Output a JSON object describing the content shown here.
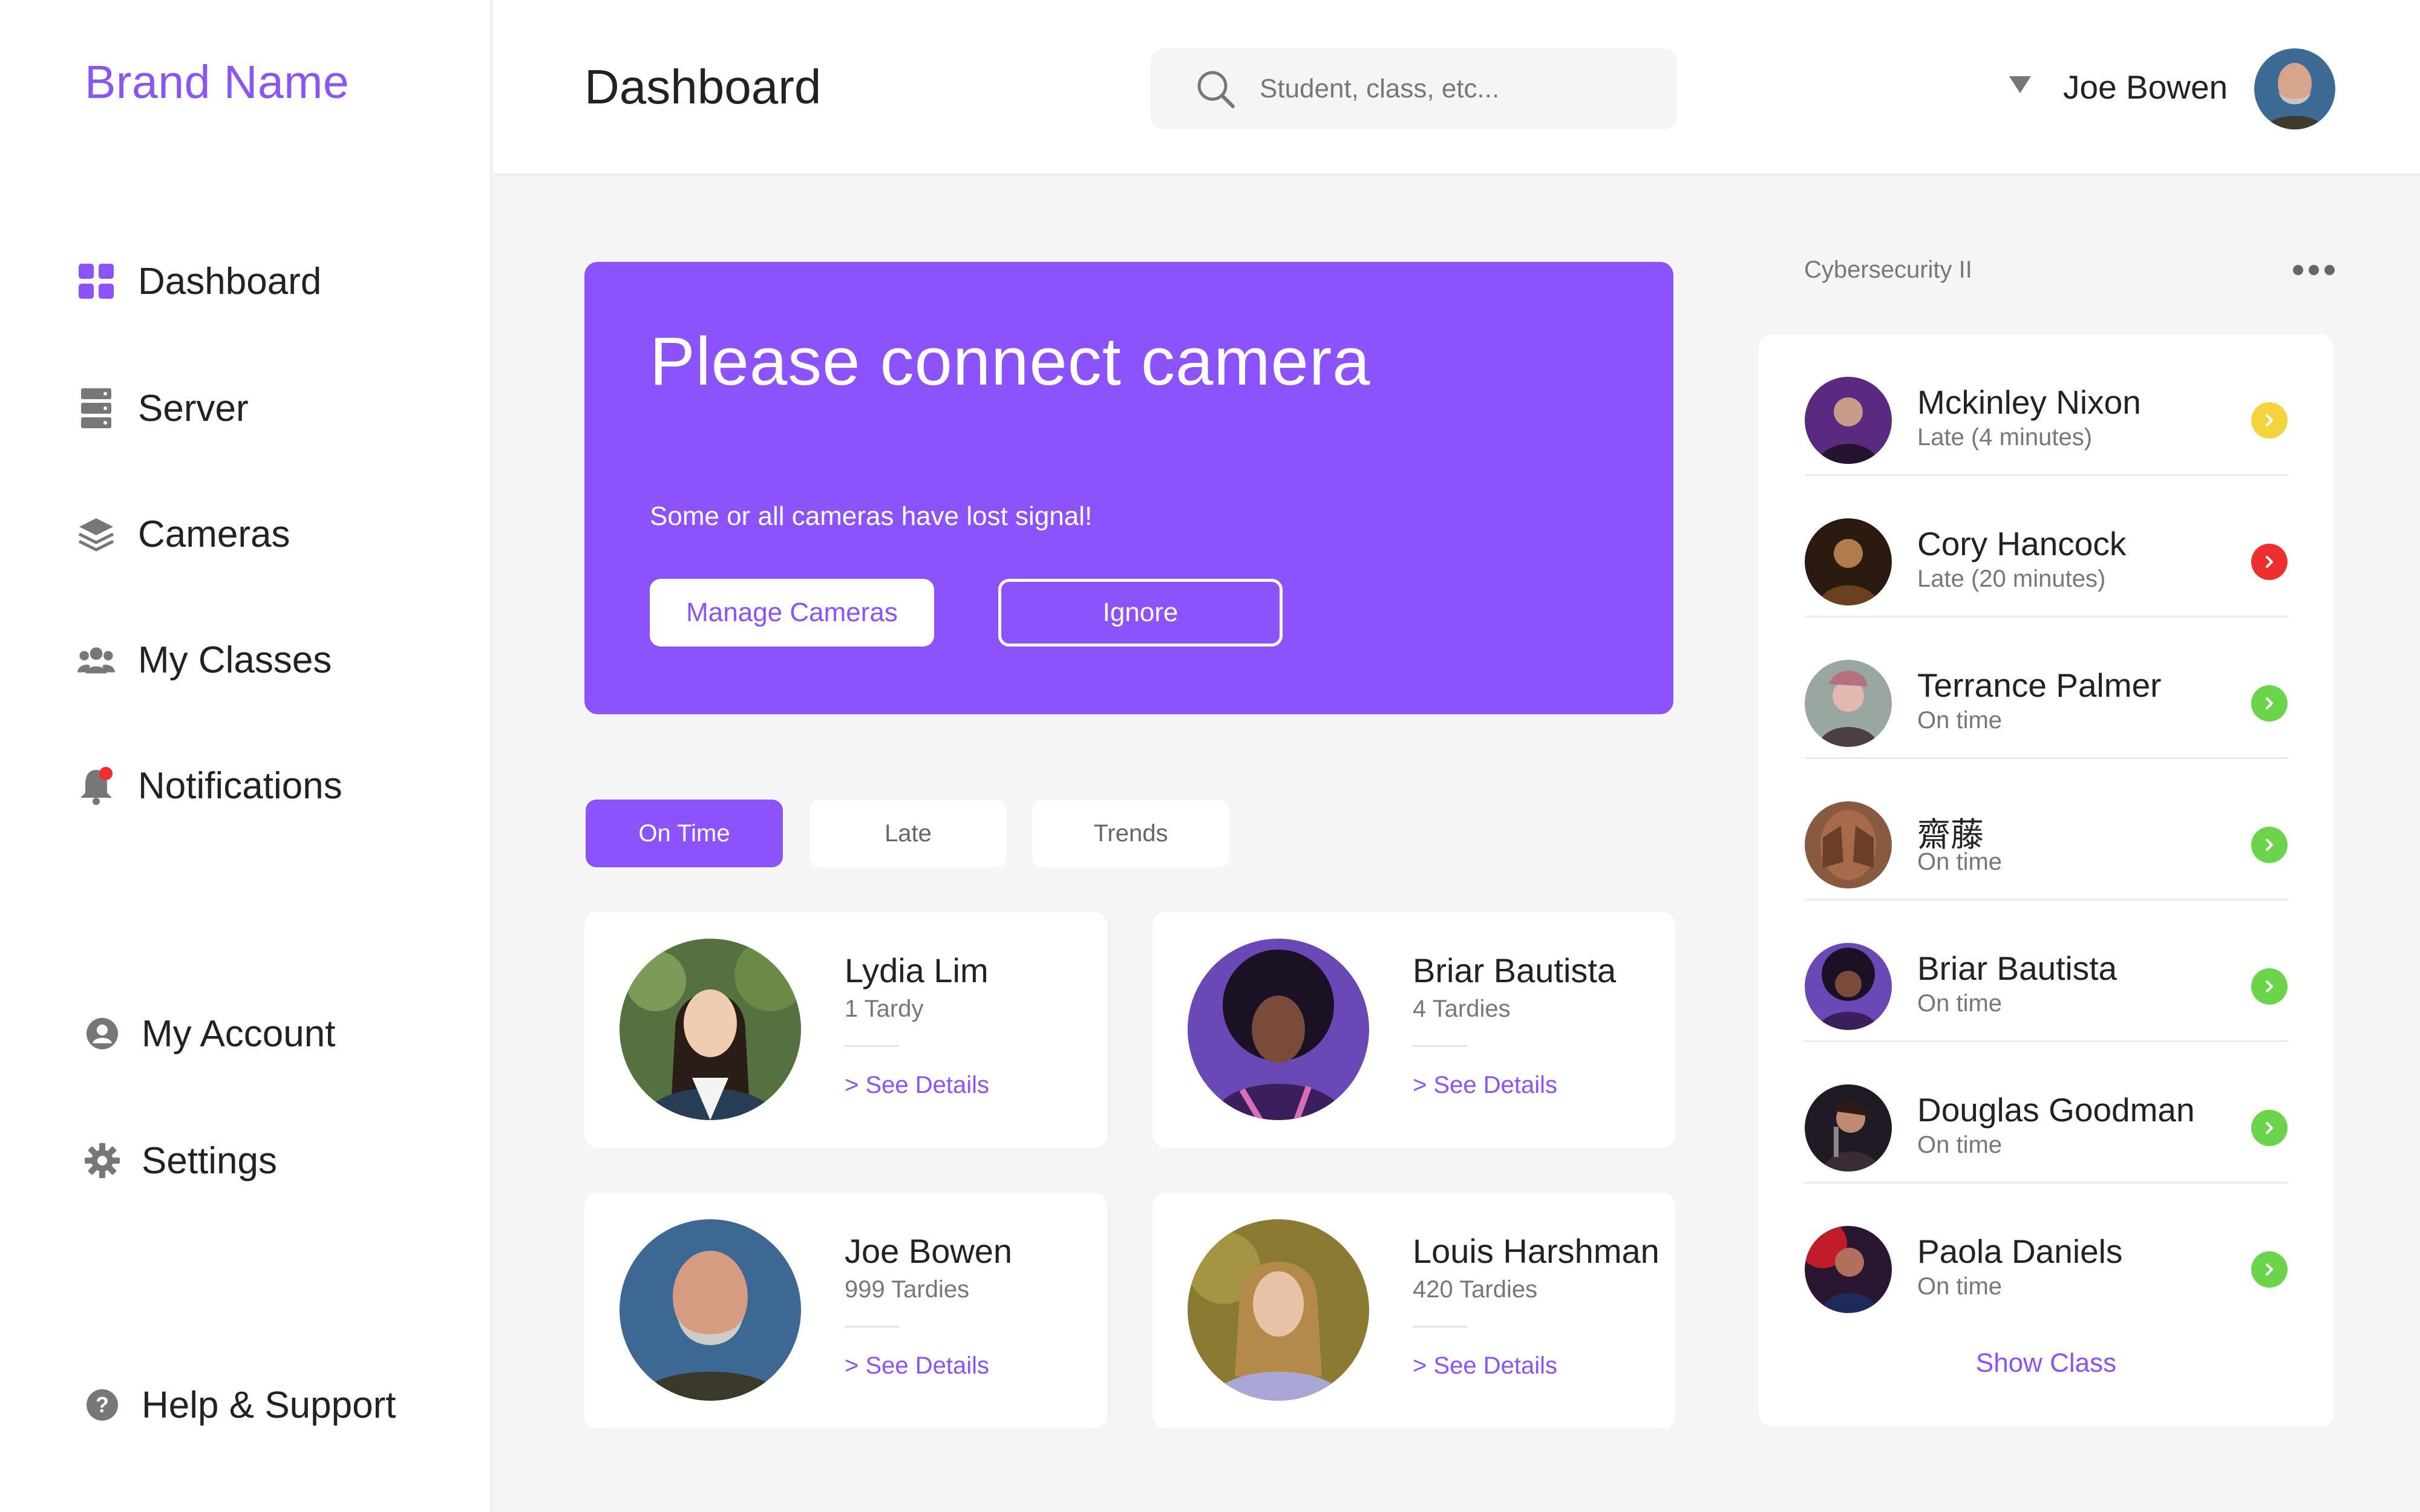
{
  "brand": "Brand Name",
  "nav": {
    "dashboard": "Dashboard",
    "server": "Server",
    "cameras": "Cameras",
    "my_classes": "My Classes",
    "notifications": "Notifications",
    "my_account": "My Account",
    "settings": "Settings",
    "help": "Help & Support"
  },
  "header": {
    "title": "Dashboard",
    "search_placeholder": "Student, class, etc...",
    "user_name": "Joe Bowen"
  },
  "alert": {
    "title": "Please connect camera",
    "subtitle": "Some or all cameras have lost signal!",
    "manage_label": "Manage Cameras",
    "ignore_label": "Ignore"
  },
  "tabs": [
    "On Time",
    "Late",
    "Trends"
  ],
  "cards": [
    {
      "name": "Lydia Lim",
      "sub": "1 Tardy",
      "link": "> See Details"
    },
    {
      "name": "Briar Bautista",
      "sub": "4 Tardies",
      "link": "> See Details"
    },
    {
      "name": "Joe Bowen",
      "sub": "999 Tardies",
      "link": "> See Details"
    },
    {
      "name": "Louis Harshman",
      "sub": "420 Tardies",
      "link": "> See Details"
    }
  ],
  "class_panel": {
    "title": "Cybersecurity II",
    "show_class": "Show Class",
    "students": [
      {
        "name": "Mckinley Nixon",
        "status": "Late (4  minutes)",
        "status_color": "#f5d33d"
      },
      {
        "name": "Cory Hancock",
        "status": "Late (20 minutes)",
        "status_color": "#ef2e2e"
      },
      {
        "name": "Terrance Palmer",
        "status": "On time",
        "status_color": "#6cd44a"
      },
      {
        "name": "齋藤",
        "status": "On time",
        "status_color": "#6cd44a"
      },
      {
        "name": "Briar Bautista",
        "status": "On time",
        "status_color": "#6cd44a"
      },
      {
        "name": "Douglas Goodman",
        "status": "On time",
        "status_color": "#6cd44a"
      },
      {
        "name": "Paola Daniels",
        "status": "On time",
        "status_color": "#6cd44a"
      }
    ]
  },
  "colors": {
    "accent": "#8c52fc",
    "on_time": "#6cd44a",
    "late_minor": "#f5d33d",
    "late_major": "#ef2e2e"
  }
}
